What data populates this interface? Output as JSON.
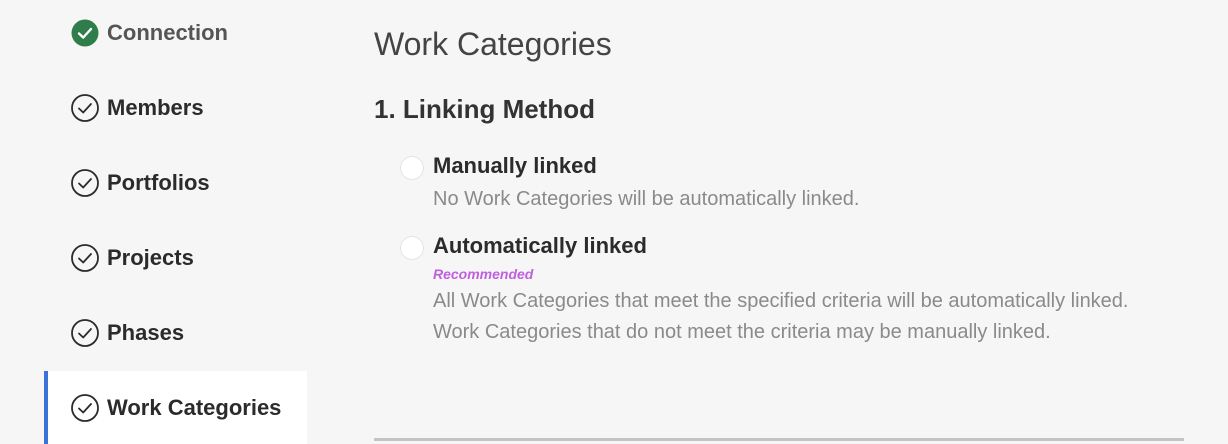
{
  "sidebar": {
    "steps": [
      {
        "label": "Connection",
        "state": "complete-filled"
      },
      {
        "label": "Members",
        "state": "complete"
      },
      {
        "label": "Portfolios",
        "state": "complete"
      },
      {
        "label": "Projects",
        "state": "complete"
      },
      {
        "label": "Phases",
        "state": "complete"
      },
      {
        "label": "Work Categories",
        "state": "active"
      }
    ],
    "active_color": "#3b73d8",
    "complete_filled_color": "#2f7d4a"
  },
  "main": {
    "title": "Work Categories",
    "section_title": "1. Linking Method",
    "options": [
      {
        "label": "Manually linked",
        "description": "No Work Categories will be automatically linked.",
        "selected": false
      },
      {
        "label": "Automatically linked",
        "badge": "Recommended",
        "description": "All Work Categories that meet the specified criteria will be automatically linked. Work Categories that do not meet the criteria may be manually linked.",
        "selected": false
      }
    ]
  },
  "icons": {
    "check_filled": "check-circle-filled-icon",
    "check_outline": "check-circle-outline-icon"
  }
}
